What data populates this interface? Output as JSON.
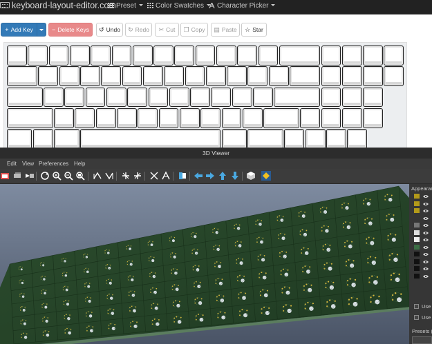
{
  "navbar": {
    "site_title": "keyboard-layout-editor.com",
    "menus": [
      {
        "label": "Preset",
        "icon": "list-icon"
      },
      {
        "label": "Color Swatches",
        "icon": "grid-icon"
      },
      {
        "label": "Character Picker",
        "icon": "font-icon"
      }
    ]
  },
  "toolbar": {
    "add_key": "Add Key",
    "delete_keys": "Delete Keys",
    "undo": "Undo",
    "redo": "Redo",
    "cut": "Cut",
    "copy": "Copy",
    "paste": "Paste",
    "star": "Star"
  },
  "viewer": {
    "title": "3D Viewer",
    "menu": [
      "Edit",
      "View",
      "Preferences",
      "Help"
    ],
    "panel": {
      "heading": "Appearan",
      "use_1": "Use",
      "use_2": "Use",
      "presets": "Presets ("
    }
  },
  "colors": {
    "accent": "#337ab7",
    "danger": "#e8898a",
    "pcb": "#2a4a2c",
    "background_3d": "#5a6678"
  }
}
